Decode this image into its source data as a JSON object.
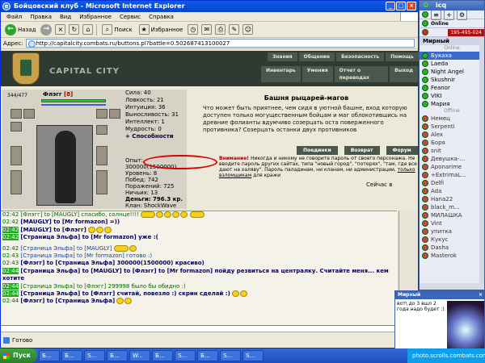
{
  "ie": {
    "title": "Бойцовский клуб - Microsoft Internet Explorer",
    "menu": [
      "Файл",
      "Правка",
      "Вид",
      "Избранное",
      "Сервис",
      "Справка"
    ],
    "toolbar": {
      "back": "Назад",
      "search": "Поиск",
      "favorites": "Избранное"
    },
    "address_label": "Адрес:",
    "address": "http://capitalcity.combats.ru/buttons.pl?battle=0.502687413100027",
    "status": "Готово"
  },
  "site": {
    "logo_text": "CAPITAL CITY",
    "nav_top": [
      "Знания",
      "Общение",
      "Безопасность",
      "Помощь"
    ],
    "nav_sub": [
      "Инвентарь",
      "Умения",
      "Отчет о переводах",
      "Выход"
    ]
  },
  "character": {
    "hp": "344/477",
    "name": "Флэгг",
    "level": "[8]",
    "stats": [
      "Сила: 40",
      "Ловкость: 21",
      "Интуиция: 36",
      "Выносливость: 31",
      "Интеллект: 1",
      "Мудрость: 0"
    ],
    "abilities": "+ Способности",
    "exp": "Опыт: 300000(1500000)",
    "level_line": "Уровень: 8",
    "wins": "Побед: 742",
    "losses": "Поражений: 725",
    "draws": "Ничьих: 13",
    "money": "Деньги: 796.3 кр.",
    "clan": "Клан: ShockWave"
  },
  "tower": {
    "title": "Башня рыцарей-магов",
    "text": "Что может быть приятнее, чем сидя в уютной башне, вход которую доступен только могущественным бойцам и маг облокотившись на древние фолианты вдумчиво созерцать оста поверженного противника? Созерцать останки двух противников"
  },
  "battle_tabs": [
    "Поединки",
    "Возврат",
    "Форум"
  ],
  "warning": {
    "prefix": "Внимание!",
    "text": "Никогда и никому не говорите пароль от своего персонажа. Не вводите пароль других сайтах, типа \"новый город\", \"потерях\", \"там, где все дают на халяву\". Пароль паладинам, ни кланам, ни администрации,",
    "underlined": "только взломщикам",
    "suffix": "для кражи"
  },
  "later": "Сейчас в",
  "chat": [
    {
      "ts": "02:42",
      "text": "[Флэгг] to [MAUGLY] спасибо, солнце!!!!",
      "style": "grn"
    },
    {
      "ts": "02:42",
      "text": "[MAUGLY] to [Mr formazon] =))",
      "style": "nick"
    },
    {
      "ts": "02:42",
      "text": "[MAUGLY] to [Флэгг]",
      "style": "nick",
      "hl": true
    },
    {
      "ts": "02:42",
      "text": "[Страница Эльфа] to [Mr formazon] уже :(",
      "style": "nick",
      "hl": true
    },
    {
      "ts": "02:42",
      "text": "[Страница Эльфа] to [MAUGLY]",
      "style": "nick"
    },
    {
      "ts": "02:43",
      "text": "[Страница Эльфа] to [Mr formazon] готово :)",
      "style": "nick"
    },
    {
      "ts": "02:43",
      "text": "[Флэгг] to [Страница Эльфа] 300000(1500000) красиво)",
      "style": "nick"
    },
    {
      "ts": "02:44",
      "text": "[Страница Эльфа] to [MAUGLY] to [Флэгг] to [Mr formazon] пойду резвиться на централку. Считайте меня... кем хотите",
      "style": "nick",
      "hl": true
    },
    {
      "ts": "02:44",
      "text": "[Страница Эльфа] to [Флэгг] 299998 было бы обидно :)",
      "style": "grn",
      "hl": true
    },
    {
      "ts": "02:44",
      "text": "[Страница Эльфа] to [Флэгг] считай, повезло :) скрин сделай :)",
      "style": "nick",
      "hl": true
    },
    {
      "ts": "02:44",
      "text": "[Флэгг] to [Страница Эльфа]",
      "style": "nick"
    }
  ],
  "icq": {
    "title": "icq",
    "status": "Online",
    "uin": "195-495-024",
    "group": "Мирный",
    "online_header": "Online",
    "offline_header": "Offline",
    "online": [
      "Букаха",
      "Laeda",
      "Night Angel",
      "Skushnir",
      "Feanor",
      "VIKI",
      "Мария"
    ],
    "offline": [
      "Немец",
      "Serpenti",
      "Alex",
      "Боря",
      "snit",
      "Девушка-...",
      "Aponarime",
      "+ExtrimaL...",
      "Delfi",
      "Ada",
      "Hana22",
      "black_m...",
      "МИЛАШКА",
      "Vint",
      "упитка",
      "Кукус",
      "Dasha",
      "Masterok"
    ]
  },
  "popup": {
    "title": "Мирный",
    "close": "×",
    "text": "вот\\ до 3 вшл 2 года надо будет :)"
  },
  "taskbar": {
    "start": "Пуск",
    "tasks": [
      "Б...",
      "Б...",
      "S...",
      "Б...",
      "W...",
      "Б...",
      "S...",
      "Б...",
      "S...",
      "S..."
    ],
    "tray": "photo.scrolls.combats.com"
  },
  "colors": {
    "accent": "#0a5ee6",
    "site_header": "#2f3b32",
    "highlight_ts": "#22aa22",
    "exp_circle": "#dd0000"
  }
}
